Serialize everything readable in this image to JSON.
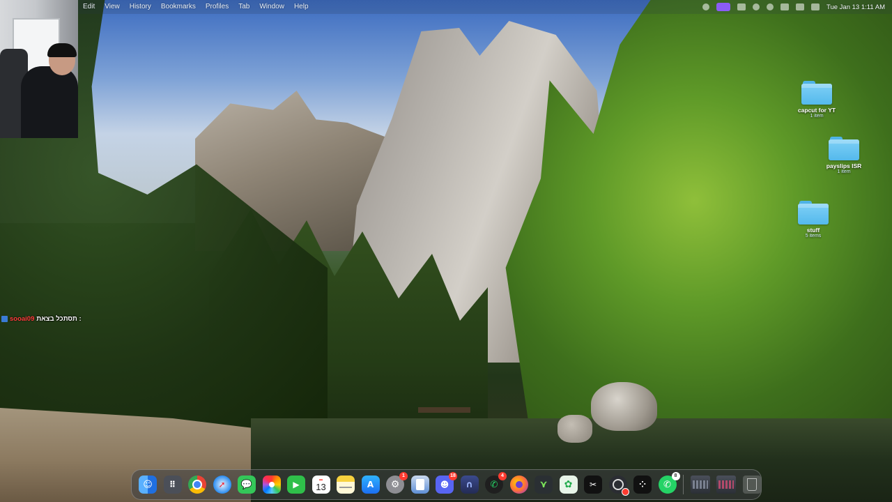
{
  "menubar": {
    "menus": [
      "Edit",
      "View",
      "History",
      "Bookmarks",
      "Profiles",
      "Tab",
      "Window",
      "Help"
    ],
    "clock": "Tue Jan 13  1:11 AM"
  },
  "chat": {
    "username": "sooai09",
    "message": "תסתכל בצאת :"
  },
  "desktop": {
    "items": [
      {
        "name": "capcut for YT",
        "meta": "1 item"
      },
      {
        "name": "payslips ISR",
        "meta": "1 item"
      },
      {
        "name": "stuff",
        "meta": "5 items"
      }
    ]
  },
  "dock": {
    "calendar_day": "13",
    "apps": [
      {
        "name": "Finder",
        "icon": "finder-icon",
        "color": "#3b8ff5"
      },
      {
        "name": "Launchpad",
        "icon": "launchpad-icon",
        "color": "#5a5f6b"
      },
      {
        "name": "Chrome",
        "icon": "chrome-icon",
        "color": "#e94235"
      },
      {
        "name": "Safari",
        "icon": "safari-icon",
        "color": "#1e88e5"
      },
      {
        "name": "Messages",
        "icon": "messages-icon",
        "color": "#34c759"
      },
      {
        "name": "Photos",
        "icon": "photos-icon",
        "color": "#f4a300"
      },
      {
        "name": "FaceTime",
        "icon": "facetime-icon",
        "color": "#2fbf4a"
      },
      {
        "name": "Calendar",
        "icon": "calendar-icon",
        "color": "#ffffff"
      },
      {
        "name": "Notes",
        "icon": "notes-icon",
        "color": "#f7d23e"
      },
      {
        "name": "App Store",
        "icon": "app-store-icon",
        "color": "#1c7ef0"
      },
      {
        "name": "System Settings",
        "icon": "settings-icon",
        "color": "#8e8e93",
        "badge": "1"
      },
      {
        "name": "Preview",
        "icon": "preview-icon",
        "color": "#5f8fd6"
      },
      {
        "name": "Discord",
        "icon": "discord-icon",
        "color": "#5865f2",
        "badge": "18"
      },
      {
        "name": "Arc",
        "icon": "arc-icon",
        "color": "#3b4a8c"
      },
      {
        "name": "WhatsApp",
        "icon": "whatsapp-icon",
        "color": "#1f1f1f",
        "badge": "4"
      },
      {
        "name": "Firefox",
        "icon": "firefox-icon",
        "color": "#ff7139"
      },
      {
        "name": "Vectorize",
        "icon": "vector-icon",
        "color": "#2a2f33"
      },
      {
        "name": "Maps App",
        "icon": "maps-icon",
        "color": "#e8f5e9"
      },
      {
        "name": "CapCut",
        "icon": "capcut-icon",
        "color": "#111111"
      },
      {
        "name": "OBS",
        "icon": "obs-icon",
        "color": "#2b2d33"
      },
      {
        "name": "Game App",
        "icon": "game-icon",
        "color": "#111111"
      },
      {
        "name": "WhatsApp",
        "icon": "whatsapp-icon",
        "color": "#25d366",
        "badge": "8"
      }
    ],
    "recent": [
      {
        "name": "Window 1",
        "icon": "window-thumbnail-icon"
      },
      {
        "name": "Window 2",
        "icon": "window-thumbnail-icon"
      }
    ],
    "trash": {
      "name": "Trash",
      "icon": "trash-icon"
    }
  }
}
